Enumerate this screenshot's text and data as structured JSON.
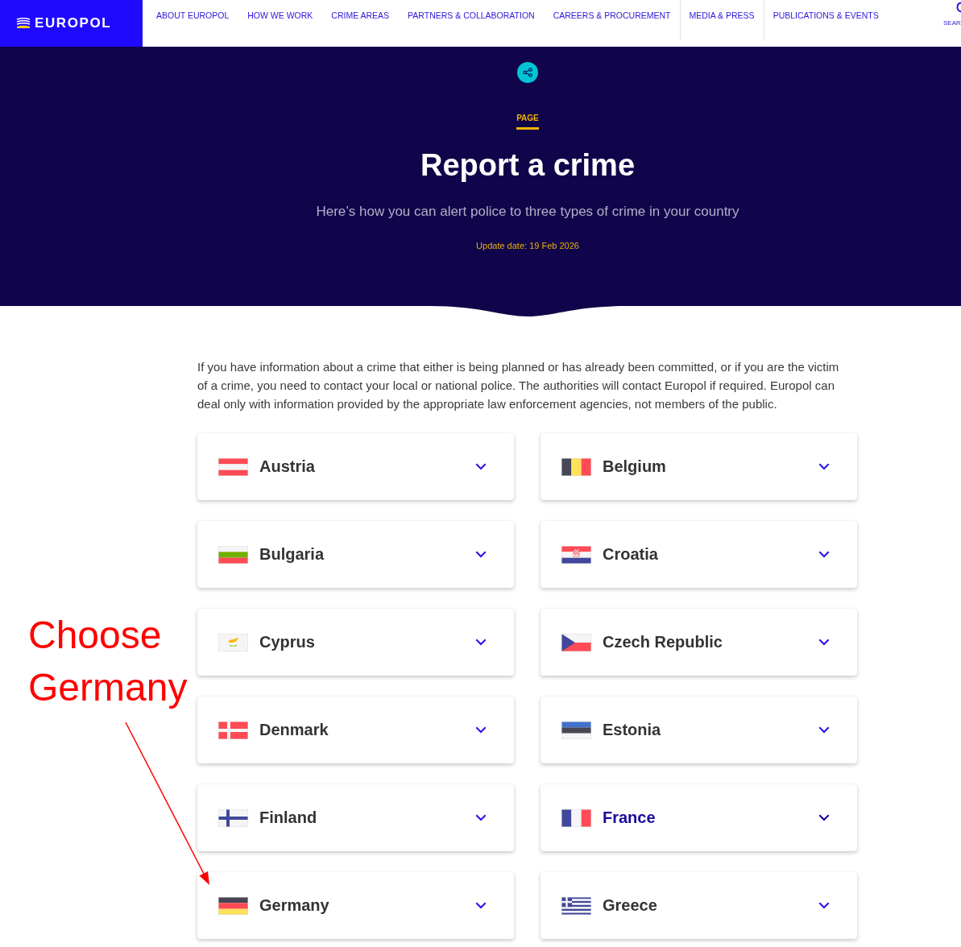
{
  "header": {
    "logo": {
      "text": "EUROPOL"
    },
    "nav": [
      {
        "label": "ABOUT EUROPOL",
        "divider": false
      },
      {
        "label": "HOW WE WORK",
        "divider": false
      },
      {
        "label": "CRIME AREAS",
        "divider": false
      },
      {
        "label": "PARTNERS & COLLABORATION",
        "divider": false
      },
      {
        "label": "CAREERS & PROCUREMENT",
        "divider": false
      },
      {
        "label": "MEDIA & PRESS",
        "divider": true
      },
      {
        "label": "PUBLICATIONS & EVENTS",
        "divider": true
      }
    ],
    "search": {
      "label": "SEAR"
    }
  },
  "hero": {
    "type_label": "PAGE",
    "title": "Report a crime",
    "subtitle": "Here’s how you can alert police to three types of crime in your country",
    "update_date": "Update date: 19 Feb 2026"
  },
  "intro": "If you have information about a crime that either is being planned or has already been committed, or if you are the victim of a crime, you need to contact your local or national police. The authorities will contact Europol if required. Europol can deal only with information provided by the appropriate law enforcement agencies, not members of the public.",
  "countries": [
    {
      "name": "Austria",
      "kind": "at",
      "highlighted": false
    },
    {
      "name": "Belgium",
      "kind": "be",
      "highlighted": false
    },
    {
      "name": "Bulgaria",
      "kind": "bg",
      "highlighted": false
    },
    {
      "name": "Croatia",
      "kind": "hr",
      "highlighted": false
    },
    {
      "name": "Cyprus",
      "kind": "cy",
      "highlighted": false
    },
    {
      "name": "Czech Republic",
      "kind": "cz",
      "highlighted": false
    },
    {
      "name": "Denmark",
      "kind": "dk",
      "highlighted": false
    },
    {
      "name": "Estonia",
      "kind": "ee",
      "highlighted": false
    },
    {
      "name": "Finland",
      "kind": "fi",
      "highlighted": false
    },
    {
      "name": "France",
      "kind": "fr",
      "highlighted": true
    },
    {
      "name": "Germany",
      "kind": "de",
      "highlighted": false
    },
    {
      "name": "Greece",
      "kind": "gr",
      "highlighted": false
    }
  ],
  "annotation": {
    "text": "Choose Germany"
  }
}
